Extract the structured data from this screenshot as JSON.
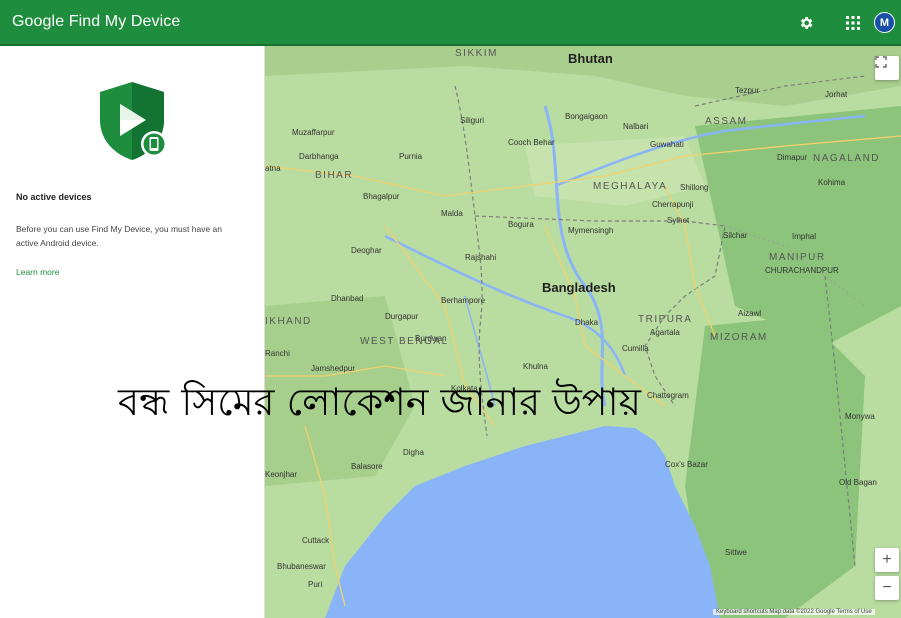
{
  "header": {
    "title": "Google Find My Device",
    "avatar_letter": "M",
    "settings_icon": "gear-icon",
    "apps_icon": "apps-grid-icon",
    "color": "#1e8e3e"
  },
  "sidebar": {
    "heading": "No active devices",
    "description": "Before you can use Find My Device, you must have an active Android device.",
    "learn_more": "Learn more",
    "logo_icon": "find-my-device-shield-icon"
  },
  "map": {
    "labels": {
      "sikkim": "SIKKIM",
      "bhutan": "Bhutan",
      "assam": "ASSAM",
      "nagaland": "NAGALAND",
      "meghalaya": "MEGHALAYA",
      "bihar": "BIHAR",
      "bangladesh": "Bangladesh",
      "manipur": "MANIPUR",
      "tripura": "TRIPURA",
      "mizoram": "MIZORAM",
      "jharkhand": "IKHAND",
      "west_bengal": "WEST BENGAL",
      "guwahati": "Guwahati",
      "shillong": "Shillong",
      "sylhet": "Sylhet",
      "imphal": "Imphal",
      "dhaka": "Dhaka",
      "rajshahi": "Rajshahi",
      "mymensingh": "Mymensingh",
      "bogura": "Bogura",
      "comilla": "Cumilla",
      "khulna": "Khulna",
      "kolkata": "Kolkata",
      "bhagalpur": "Bhagalpur",
      "darbhanga": "Darbhanga",
      "purnia": "Purnia",
      "muzaffarpur": "Muzaffarpur",
      "dhanbad": "Dhanbad",
      "durgapur": "Durgapur",
      "jamshedpur": "Jamshedpur",
      "ranchi": "Ranchi",
      "balasore": "Balasore",
      "cuttack": "Cuttack",
      "bhubaneswar": "Bhubaneswar",
      "puri": "Puri",
      "coxs_bazar": "Cox's Bazar",
      "digha": "Digha",
      "siliguri": "Siliguri",
      "cooch_behar": "Cooch Behar",
      "maida": "Malda",
      "berhampore": "Berhampore",
      "burdwan": "Burdwan",
      "deoghar": "Deoghar",
      "patna": "atna",
      "kohima": "Kohima",
      "aizawl": "Aizawl",
      "chittagong": "Chattogram",
      "monywa": "Monywa",
      "old_bagan": "Old Bagan",
      "sittwe": "Sittwe",
      "bongaigaon": "Bongaigaon",
      "nalbari": "Nalbari",
      "tezpur": "Tezpur",
      "jorhat": "Jorhat",
      "dimapur": "Dimapur",
      "silchar": "Silchar",
      "agartala": "Agartala",
      "churachandpur": "CHURACHANDPUR",
      "cherrapunji": "Cherrapunji",
      "keonjhar": "Keonjhar"
    },
    "attribution": "Keyboard shortcuts   Map data ©2022 Google   Terms of Use",
    "fullscreen_icon": "fullscreen-icon",
    "zoom_in_label": "+",
    "zoom_out_label": "−",
    "water_color": "#8ab4f8",
    "land_color": "#b9dca1"
  },
  "overlay": {
    "caption": "বন্ধ সিমের লোকেশন জানার উপায়"
  }
}
